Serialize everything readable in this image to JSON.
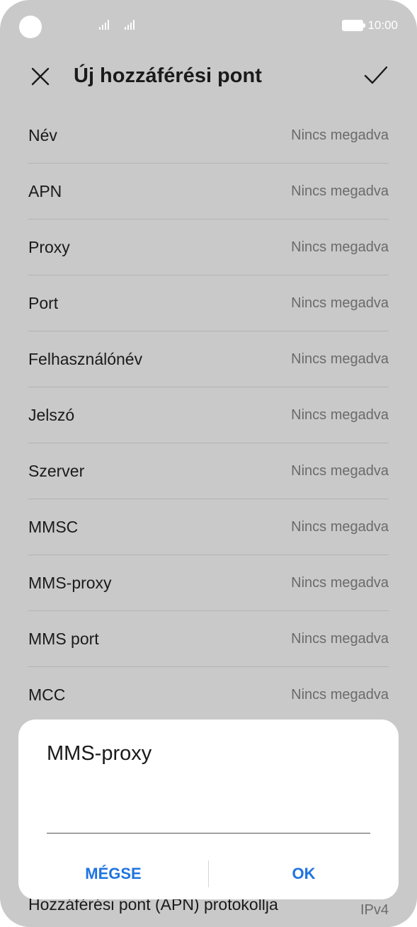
{
  "status_bar": {
    "time": "10:00"
  },
  "header": {
    "title": "Új hozzáférési pont"
  },
  "fields": [
    {
      "label": "Név",
      "value": "Nincs megadva"
    },
    {
      "label": "APN",
      "value": "Nincs megadva"
    },
    {
      "label": "Proxy",
      "value": "Nincs megadva"
    },
    {
      "label": "Port",
      "value": "Nincs megadva"
    },
    {
      "label": "Felhasználónév",
      "value": "Nincs megadva"
    },
    {
      "label": "Jelszó",
      "value": "Nincs megadva"
    },
    {
      "label": "Szerver",
      "value": "Nincs megadva"
    },
    {
      "label": "MMSC",
      "value": "Nincs megadva"
    },
    {
      "label": "MMS-proxy",
      "value": "Nincs megadva"
    },
    {
      "label": "MMS port",
      "value": "Nincs megadva"
    },
    {
      "label": "MCC",
      "value": "Nincs megadva"
    }
  ],
  "bottom_row": {
    "label": "Hozzáférési pont (APN) protokollja",
    "value": "IPv4"
  },
  "dialog": {
    "title": "MMS-proxy",
    "input_value": "",
    "cancel_label": "MÉGSE",
    "ok_label": "OK"
  },
  "colors": {
    "accent": "#1f74e0",
    "overlay_background": "#c9c9c9"
  }
}
